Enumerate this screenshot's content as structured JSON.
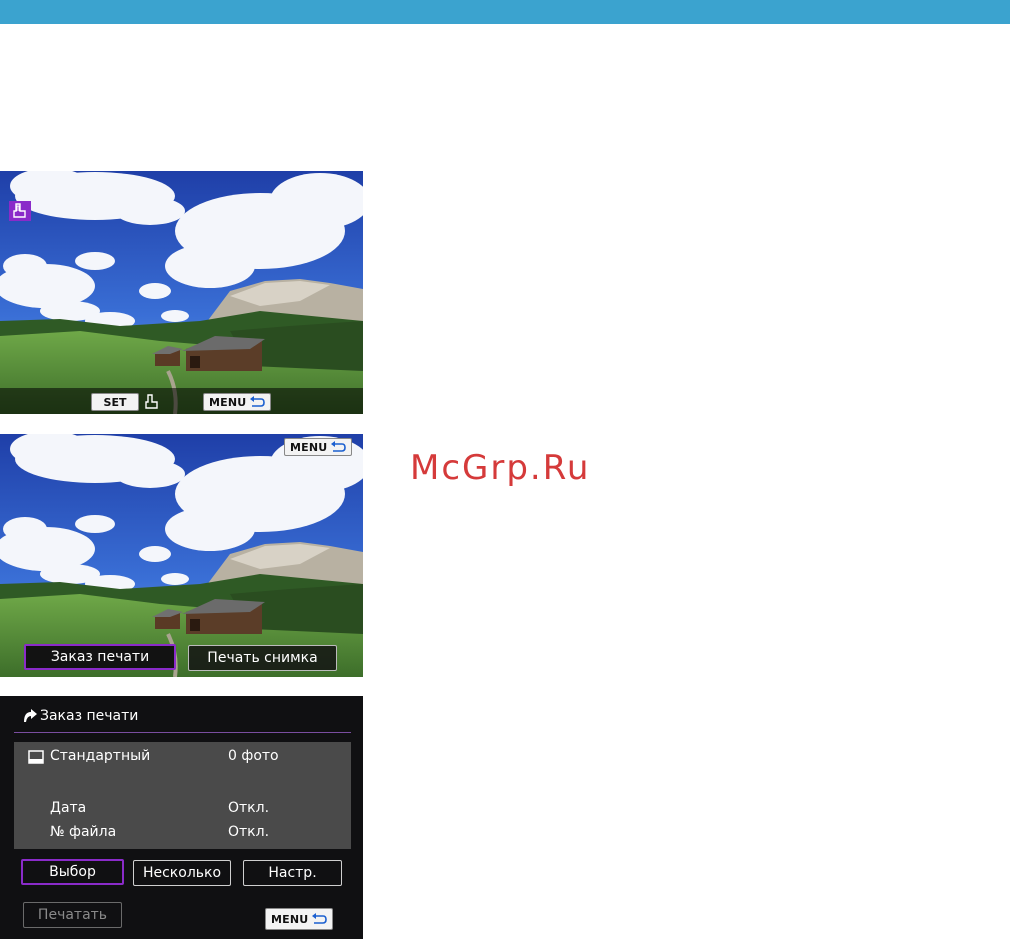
{
  "screen1": {
    "print_icon": "print-order-icon",
    "set_label": "SET",
    "set_icon": "print-order-icon",
    "menu_label": "MENU",
    "return_icon": "return-arrow-icon"
  },
  "screen2": {
    "menu_label": "MENU",
    "return_icon": "return-arrow-icon",
    "options": [
      {
        "label": "Заказ печати",
        "selected": true
      },
      {
        "label": "Печать снимка",
        "selected": false
      }
    ]
  },
  "screen3": {
    "title": "Заказ печати",
    "title_icon": "playback-tab-icon",
    "rows": [
      {
        "label": "Стандартный",
        "value": "0 фото",
        "icon": "standard-print-icon"
      },
      {
        "label": "Дата",
        "value": "Откл."
      },
      {
        "label": "№ файла",
        "value": "Откл."
      }
    ],
    "buttons": {
      "select": "Выбор",
      "multiple": "Несколько",
      "setup": "Настр.",
      "print": "Печатать"
    },
    "menu_label": "MENU",
    "return_icon": "return-arrow-icon"
  },
  "watermark": "McGrp.Ru",
  "colors": {
    "topbar": "#3ba3cf",
    "accent_purple": "#8a2bc9",
    "watermark": "#d53a3a"
  }
}
